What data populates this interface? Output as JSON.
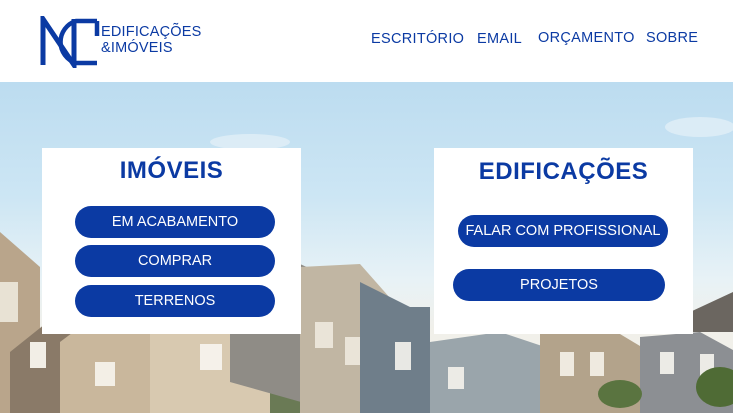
{
  "logo": {
    "line1": "EDIFICAÇÕES",
    "line2": "&IMÓVEIS",
    "color": "#0b3aa3"
  },
  "nav": {
    "items": [
      "ESCRITÓRIO",
      "EMAIL",
      "ORÇAMENTO",
      "SOBRE"
    ]
  },
  "imoveis": {
    "title": "IMÓVEIS",
    "buttons": [
      "EM ACABAMENTO",
      "COMPRAR",
      "TERRENOS"
    ]
  },
  "edificacoes": {
    "title": "EDIFICAÇÕES",
    "buttons": [
      "FALAR COM PROFISSIONAL",
      "PROJETOS"
    ]
  },
  "colors": {
    "accent": "#0b3aa3",
    "sky": "#bcdcf0"
  },
  "hero": {
    "image": "suburban-houses-photo"
  }
}
